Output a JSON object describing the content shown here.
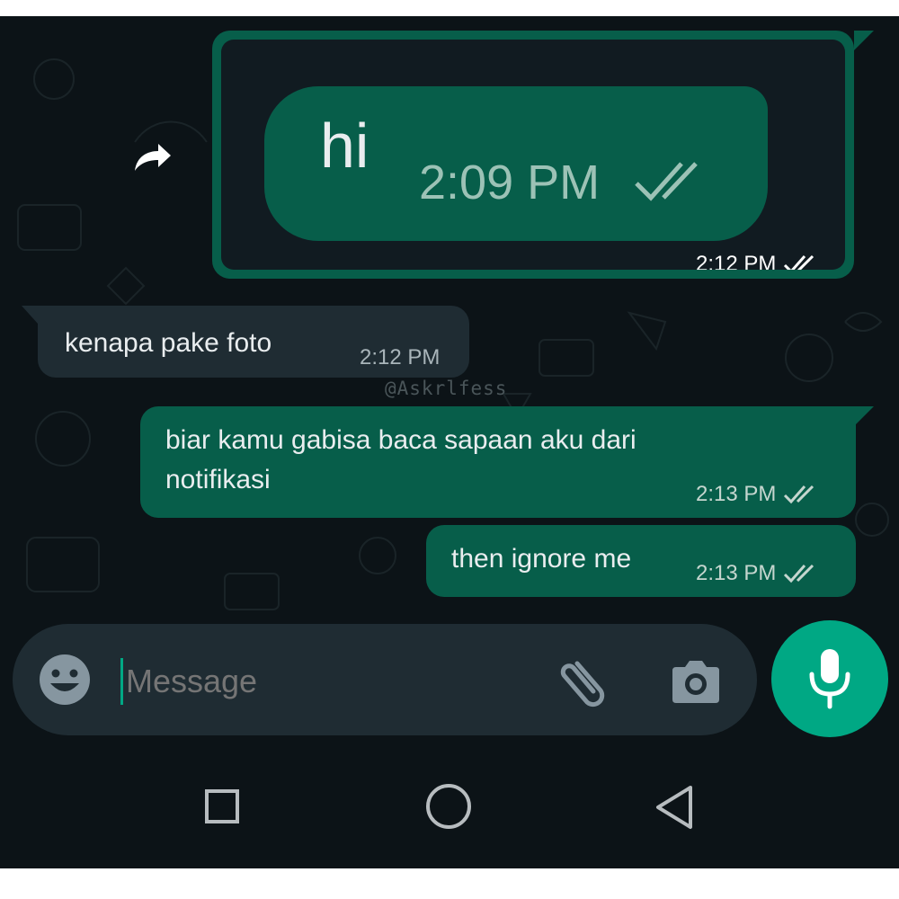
{
  "forwarded_image": {
    "text": "hi",
    "inner_time": "2:09 PM",
    "time": "2:12 PM"
  },
  "messages": [
    {
      "direction": "incoming",
      "text": "kenapa pake foto",
      "time": "2:12 PM"
    },
    {
      "direction": "outgoing",
      "lines": [
        "biar kamu gabisa baca sapaan aku dari",
        "notifikasi"
      ],
      "time": "2:13 PM"
    },
    {
      "direction": "outgoing",
      "text": "then ignore me",
      "time": "2:13 PM"
    }
  ],
  "watermark": "@Askrlfess",
  "composer": {
    "placeholder": "Message",
    "icons": [
      "emoji-icon",
      "attach-icon",
      "camera-icon",
      "mic-icon"
    ]
  },
  "navbar": {
    "icons": [
      "recent-apps-icon",
      "home-icon",
      "back-icon"
    ]
  },
  "colors": {
    "background": "#0c1317",
    "outgoing_bubble": "#075e4a",
    "incoming_bubble": "#1f2c33",
    "accent": "#00a884"
  }
}
